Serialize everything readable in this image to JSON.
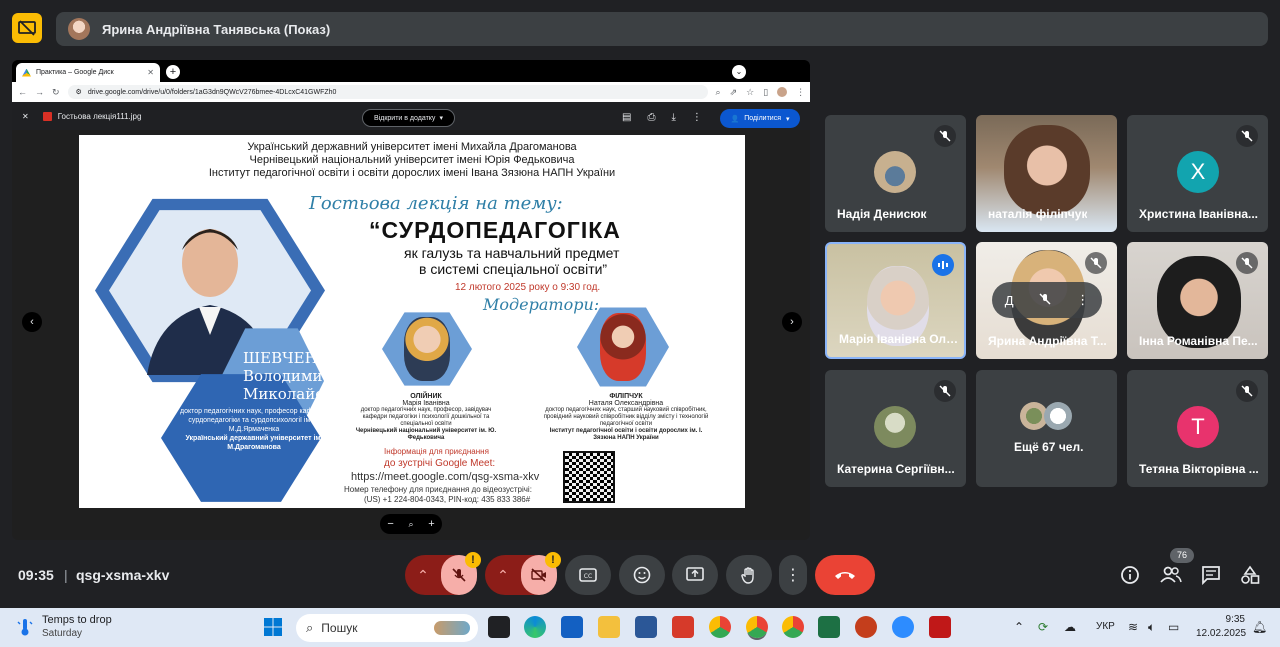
{
  "presenter": {
    "name": "Ярина Андріївна Танявська (Показ)"
  },
  "browser": {
    "tab_title": "Практика – Google Диск",
    "url": "drive.google.com/drive/u/0/folders/1aG3dn9QWcV276bmee-4DLcxC41GWFZh0",
    "viewer": {
      "file_name": "Гостьова лекція111.jpg",
      "open_with_label": "Відкрити в додатку",
      "share_label": "Поділитися"
    }
  },
  "poster": {
    "header": [
      "Український державний університет імені Михайла Драгоманова",
      "Чернівецький національний університет імені Юрія Федьковича",
      "Інститут педагогічної освіти і освіти дорослих імені Івана Зязюна НАПН України"
    ],
    "subtitle": "Гостьова лекція на тему:",
    "topic": "“СУРДОПЕДАГОГІКА",
    "topic_line2": "як галузь та навчальний предмет",
    "topic_line3": "в системі спеціальної освіти”",
    "date": "12 лютого 2025 року о 9:30 год.",
    "moderators_label": "Модератори:",
    "speaker": {
      "surname": "ШЕВЧЕНКО",
      "first_name": "Володимир",
      "patronymic": "Миколайович",
      "description": "доктор педагогічних наук, професор кафедри сурдопедагогіки та сурдопсихології імені М.Д.Ярмаченка",
      "university": "Український державний університет ім. М.Драгоманова"
    },
    "moderator1": {
      "surname": "ОЛІЙНИК",
      "name": "Марія Іванівна",
      "desc": "доктор педагогічних наук, професор, завідувач кафедри педагогіки і психології дошкільної та спеціальної освіти",
      "org": "Чернівецький національний університет ім. Ю. Федьковича"
    },
    "moderator2": {
      "surname": "ФІЛІПЧУК",
      "name": "Наталя Олександрівна",
      "desc": "доктор педагогічних наук, старший науковий співробітник, провідний науковий співробітник відділу змісту і технологій педагогічної освіти",
      "org": "Інститут педагогічної освіти і освіти дорослих ім. І. Зязюна НАПН України"
    },
    "info_line1": "Інформація для приєднання",
    "info_line2": "до зустрічі Google Meet:",
    "link": "https://meet.google.com/qsg-xsma-xkv",
    "phone_line1": "Номер телефону для приєднання до відеозустрічі:",
    "phone_line2": "(US) +1 224-804-0343, PIN-код: 435 833 386#"
  },
  "participants": [
    {
      "name": "Надія Денисюк",
      "muted": true
    },
    {
      "name": "наталія філіпчук",
      "muted": false
    },
    {
      "name": "Христина Іванівна...",
      "muted": true,
      "letter": "Х",
      "color": "#12a4af"
    },
    {
      "name": "Марія Іванівна Олі...",
      "speaking": true
    },
    {
      "name": "Ярина Андріївна Т...",
      "muted": true,
      "overlay_letter": "Д"
    },
    {
      "name": "Інна Романівна Пе...",
      "muted": true
    },
    {
      "name": "Катерина Сергіївн...",
      "muted": true
    },
    {
      "name": "Ещё 67 чел."
    },
    {
      "name": "Тетяна Вікторівна ...",
      "muted": true,
      "letter": "Т",
      "color": "#e8336d"
    }
  ],
  "controls": {
    "time": "09:35",
    "separator": "|",
    "meeting_code": "qsg-xsma-xkv",
    "participants_count": "76",
    "accent_red": "#ea4335",
    "warn_symbol": "!"
  },
  "taskbar": {
    "weather_line1": "Temps to drop",
    "weather_line2": "Saturday",
    "search_placeholder": "Пошук",
    "language": "УКР",
    "time": "9:35",
    "date": "12.02.2025"
  }
}
